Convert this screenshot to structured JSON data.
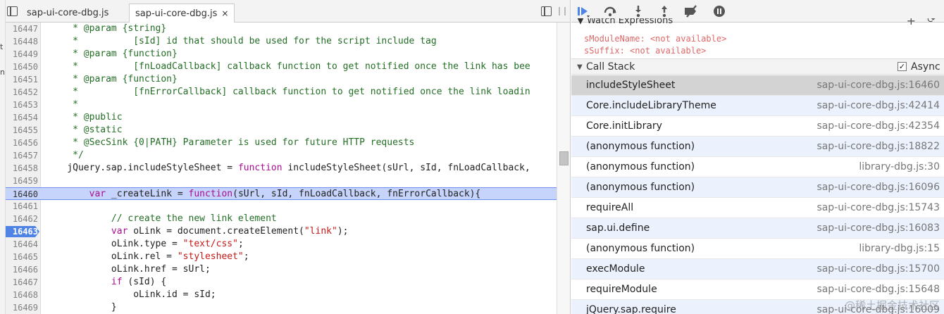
{
  "tabs": [
    {
      "label": "sap-ui-core-dbg.js",
      "active": false
    },
    {
      "label": "sap-ui-core-dbg.js",
      "active": true,
      "close": "×"
    }
  ],
  "left_edge_fragments": [
    "t",
    "n"
  ],
  "code_lines": [
    {
      "n": "16447",
      "parts": [
        {
          "t": "     * @param {string}",
          "c": "cm"
        }
      ]
    },
    {
      "n": "16448",
      "parts": [
        {
          "t": "     *          [sId] id that should be used for the script include tag",
          "c": "cm"
        }
      ]
    },
    {
      "n": "16449",
      "parts": [
        {
          "t": "     * @param {function}",
          "c": "cm"
        }
      ]
    },
    {
      "n": "16450",
      "parts": [
        {
          "t": "     *          [fnLoadCallback] callback function to get notified once the link has bee",
          "c": "cm"
        }
      ]
    },
    {
      "n": "16451",
      "parts": [
        {
          "t": "     * @param {function}",
          "c": "cm"
        }
      ]
    },
    {
      "n": "16452",
      "parts": [
        {
          "t": "     *          [fnErrorCallback] callback function to get notified once the link loadin",
          "c": "cm"
        }
      ]
    },
    {
      "n": "16453",
      "parts": [
        {
          "t": "     *",
          "c": "cm"
        }
      ]
    },
    {
      "n": "16454",
      "parts": [
        {
          "t": "     * @public",
          "c": "cm"
        }
      ]
    },
    {
      "n": "16455",
      "parts": [
        {
          "t": "     * @static",
          "c": "cm"
        }
      ]
    },
    {
      "n": "16456",
      "parts": [
        {
          "t": "     * @SecSink {0|PATH} Parameter is used for future HTTP requests",
          "c": "cm"
        }
      ]
    },
    {
      "n": "16457",
      "parts": [
        {
          "t": "     */",
          "c": "cm"
        }
      ]
    },
    {
      "n": "16458",
      "parts": [
        {
          "t": "    jQuery.sap.includeStyleSheet = ",
          "c": ""
        },
        {
          "t": "function",
          "c": "kw"
        },
        {
          "t": " includeStyleSheet(sUrl, sId, fnLoadCallback,",
          "c": ""
        }
      ]
    },
    {
      "n": "16459",
      "parts": []
    },
    {
      "n": "16460",
      "exec": true,
      "parts": [
        {
          "t": "        ",
          "c": ""
        },
        {
          "t": "var",
          "c": "kw"
        },
        {
          "t": " _createLink = ",
          "c": ""
        },
        {
          "t": "function",
          "c": "kw"
        },
        {
          "t": "(sUrl, sId, fnLoadCallback, fnErrorCallback){",
          "c": ""
        }
      ]
    },
    {
      "n": "16461",
      "parts": []
    },
    {
      "n": "16462",
      "parts": [
        {
          "t": "            // create the new link element",
          "c": "cmc"
        }
      ]
    },
    {
      "n": "16463",
      "bp": true,
      "parts": [
        {
          "t": "            ",
          "c": ""
        },
        {
          "t": "var",
          "c": "kw"
        },
        {
          "t": " oLink = document.createElement(",
          "c": ""
        },
        {
          "t": "\"link\"",
          "c": "str"
        },
        {
          "t": ");",
          "c": ""
        }
      ]
    },
    {
      "n": "16464",
      "parts": [
        {
          "t": "            oLink.type = ",
          "c": ""
        },
        {
          "t": "\"text/css\"",
          "c": "str"
        },
        {
          "t": ";",
          "c": ""
        }
      ]
    },
    {
      "n": "16465",
      "parts": [
        {
          "t": "            oLink.rel = ",
          "c": ""
        },
        {
          "t": "\"stylesheet\"",
          "c": "str"
        },
        {
          "t": ";",
          "c": ""
        }
      ]
    },
    {
      "n": "16466",
      "parts": [
        {
          "t": "            oLink.href = sUrl;",
          "c": ""
        }
      ]
    },
    {
      "n": "16467",
      "parts": [
        {
          "t": "            ",
          "c": ""
        },
        {
          "t": "if",
          "c": "kw"
        },
        {
          "t": " (sId) {",
          "c": ""
        }
      ]
    },
    {
      "n": "16468",
      "parts": [
        {
          "t": "                oLink.id = sId;",
          "c": ""
        }
      ]
    },
    {
      "n": "16469",
      "parts": [
        {
          "t": "            }",
          "c": ""
        }
      ]
    }
  ],
  "watch": {
    "header": "Watch Expressions",
    "items": [
      {
        "name": "sModuleName:",
        "value": "<not available>"
      },
      {
        "name": "sSuffix:",
        "value": "<not available>"
      }
    ]
  },
  "callstack": {
    "title": "Call Stack",
    "async_label": "Async",
    "async_checked": "✓",
    "frames": [
      {
        "fn": "includeStyleSheet",
        "loc": "sap-ui-core-dbg.js:16460",
        "selected": true
      },
      {
        "fn": "Core.includeLibraryTheme",
        "loc": "sap-ui-core-dbg.js:42414"
      },
      {
        "fn": "Core.initLibrary",
        "loc": "sap-ui-core-dbg.js:42354"
      },
      {
        "fn": "(anonymous function)",
        "loc": "sap-ui-core-dbg.js:18822"
      },
      {
        "fn": "(anonymous function)",
        "loc": "library-dbg.js:30"
      },
      {
        "fn": "(anonymous function)",
        "loc": "sap-ui-core-dbg.js:16096"
      },
      {
        "fn": "requireAll",
        "loc": "sap-ui-core-dbg.js:15743"
      },
      {
        "fn": "sap.ui.define",
        "loc": "sap-ui-core-dbg.js:16083"
      },
      {
        "fn": "(anonymous function)",
        "loc": "library-dbg.js:15"
      },
      {
        "fn": "execModule",
        "loc": "sap-ui-core-dbg.js:15700"
      },
      {
        "fn": "requireModule",
        "loc": "sap-ui-core-dbg.js:15648"
      },
      {
        "fn": "jQuery.sap.require",
        "loc": "sap-ui-core-dbg.js:16009"
      }
    ]
  },
  "watermark": "@稀土掘金技术社区",
  "colors": {
    "accent": "#4f84e6",
    "exec_line": "#c6d4fb",
    "selected_frame": "#d3d3d3",
    "alt_row": "#ebf1fd"
  }
}
